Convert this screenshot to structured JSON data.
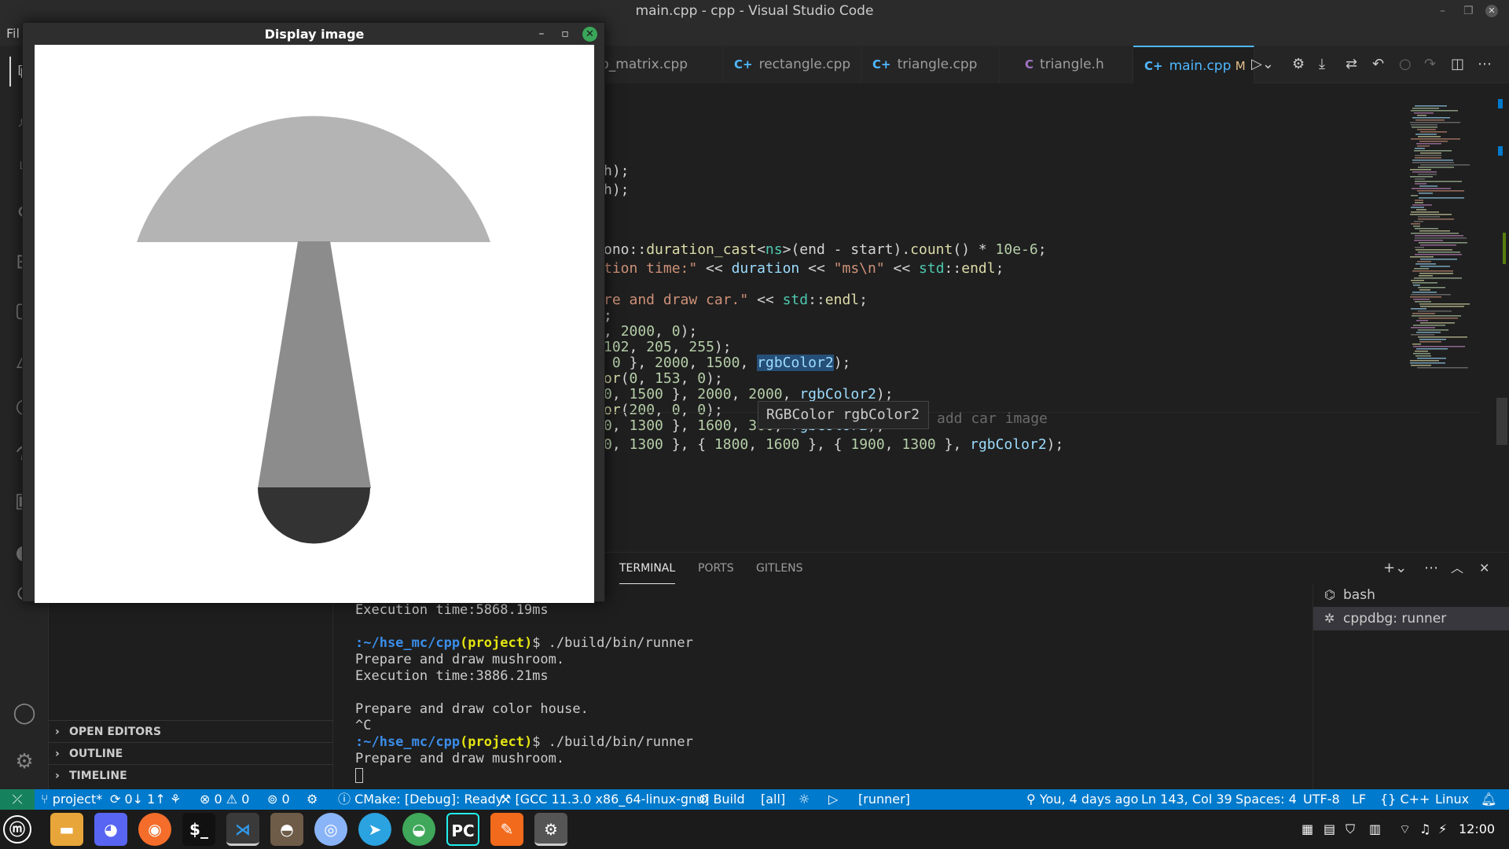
{
  "window": {
    "title": "main.cpp - cpp - Visual Studio Code",
    "controls": [
      "–",
      "❐",
      "✕"
    ]
  },
  "menu": {
    "visible_label": "Fil"
  },
  "tabs": [
    {
      "label": "b_matrix.cpp",
      "icon": ""
    },
    {
      "label": "rectangle.cpp",
      "icon": "C+"
    },
    {
      "label": "triangle.cpp",
      "icon": "C+"
    },
    {
      "label": "triangle.h",
      "icon": "C"
    },
    {
      "label": "main.cpp",
      "icon": "C+",
      "badge": "M",
      "active": true
    }
  ],
  "editor": {
    "lines": [
      [
        [
          "h);",
          ""
        ]
      ],
      [
        [
          "h);",
          ""
        ]
      ],
      [
        [
          "ono::",
          ""
        ],
        [
          "duration_cast",
          "fn"
        ],
        [
          "<",
          ""
        ],
        [
          "ns",
          "type"
        ],
        [
          ">(end - start).",
          ""
        ],
        [
          "count",
          "fn"
        ],
        [
          "() * ",
          ""
        ],
        [
          "10e-6",
          "num"
        ],
        [
          ";",
          ""
        ]
      ],
      [
        [
          "tion time:\"",
          "str"
        ],
        [
          " << ",
          ""
        ],
        [
          "duration",
          "var"
        ],
        [
          " << ",
          ""
        ],
        [
          "\"ms\\n\"",
          "str"
        ],
        [
          " << ",
          ""
        ],
        [
          "std",
          "type"
        ],
        [
          "::",
          ""
        ],
        [
          "endl",
          "fn"
        ],
        [
          ";",
          ""
        ]
      ],
      [
        [
          "re and draw car.\"",
          "str"
        ],
        [
          " << ",
          ""
        ],
        [
          "std",
          "type"
        ],
        [
          "::",
          ""
        ],
        [
          "endl",
          "fn"
        ],
        [
          ";",
          ""
        ]
      ],
      [
        [
          ";",
          ""
        ]
      ],
      [
        [
          ", ",
          ""
        ],
        [
          "2000",
          "num"
        ],
        [
          ", ",
          ""
        ],
        [
          "0",
          "num"
        ],
        [
          ");",
          ""
        ]
      ],
      [
        [
          "102",
          "num"
        ],
        [
          ", ",
          ""
        ],
        [
          "205",
          "num"
        ],
        [
          ", ",
          ""
        ],
        [
          "255",
          "num"
        ],
        [
          ");",
          ""
        ]
      ],
      [
        [
          " ",
          ""
        ],
        [
          "0",
          "num"
        ],
        [
          " }, ",
          ""
        ],
        [
          "2000",
          "num"
        ],
        [
          ", ",
          ""
        ],
        [
          "1500",
          "num"
        ],
        [
          ", ",
          ""
        ],
        [
          "rgbColor2",
          "hl"
        ],
        [
          ");",
          ""
        ]
      ],
      [
        [
          "or",
          "fn"
        ],
        [
          "(",
          ""
        ],
        [
          "0",
          "num"
        ],
        [
          ", ",
          ""
        ],
        [
          "153",
          "num"
        ],
        [
          ", ",
          ""
        ],
        [
          "0",
          "num"
        ],
        [
          ");",
          ""
        ]
      ],
      [
        [
          "0",
          "num"
        ],
        [
          ", ",
          ""
        ],
        [
          "1500",
          "num"
        ],
        [
          " }, ",
          ""
        ],
        [
          "2000",
          "num"
        ],
        [
          ", ",
          ""
        ],
        [
          "2000",
          "num"
        ],
        [
          ", ",
          ""
        ],
        [
          "rgbColor2",
          "var"
        ],
        [
          ");",
          ""
        ]
      ],
      [
        [
          "or",
          "fn"
        ],
        [
          "(",
          ""
        ],
        [
          "200",
          "num"
        ],
        [
          ", ",
          ""
        ],
        [
          "0",
          "num"
        ],
        [
          ", ",
          ""
        ],
        [
          "0",
          "num"
        ],
        [
          ");",
          ""
        ]
      ],
      [
        [
          "0",
          "num"
        ],
        [
          ", ",
          ""
        ],
        [
          "1300",
          "num"
        ],
        [
          " }, ",
          ""
        ],
        [
          "1600",
          "num"
        ],
        [
          ", ",
          ""
        ],
        [
          "300",
          "num"
        ],
        [
          ", ",
          ""
        ],
        [
          "rgbColor2",
          "var"
        ],
        [
          ");",
          ""
        ]
      ],
      [
        [
          "0",
          "num"
        ],
        [
          ", ",
          ""
        ],
        [
          "1300",
          "num"
        ],
        [
          " }, { ",
          ""
        ],
        [
          "1800",
          "num"
        ],
        [
          ", ",
          ""
        ],
        [
          "1600",
          "num"
        ],
        [
          " }, { ",
          ""
        ],
        [
          "1900",
          "num"
        ],
        [
          ", ",
          ""
        ],
        [
          "1300",
          "num"
        ],
        [
          " }, ",
          ""
        ],
        [
          "rgbColor2",
          "var"
        ],
        [
          ");",
          ""
        ]
      ]
    ],
    "hover_text": "RGBColor rgbColor2",
    "ghost_text": "add car image"
  },
  "sidebar": {
    "sections": [
      "OPEN EDITORS",
      "OUTLINE",
      "TIMELINE"
    ]
  },
  "panel": {
    "tabs": [
      "TERMINAL",
      "PORTS",
      "GITLENS"
    ],
    "active_tab": "TERMINAL",
    "terminal_lines": [
      {
        "text": "Execution time:5868.19ms"
      },
      {
        "text": ""
      },
      {
        "prompt": true,
        "path": ":~/hse_mc/cpp",
        "branch": "(project)",
        "cmd": "$ ./build/bin/runner"
      },
      {
        "text": "Prepare and draw mushroom."
      },
      {
        "text": "Execution time:3886.21ms"
      },
      {
        "text": ""
      },
      {
        "text": "Prepare and draw color house."
      },
      {
        "text": "^C"
      },
      {
        "prompt": true,
        "path": ":~/hse_mc/cpp",
        "branch": "(project)",
        "cmd": "$ ./build/bin/runner"
      },
      {
        "text": "Prepare and draw mushroom."
      }
    ],
    "terminal_list": [
      "bash",
      "cppdbg: runner"
    ]
  },
  "statusbar": {
    "branch": "project*",
    "sync": "0↓ 1↑",
    "problems": "⊗ 0 ⚠ 0",
    "ports": "0",
    "cmake": "CMake: [Debug]: Ready",
    "kit": "[GCC 11.3.0 x86_64-linux-gnu]",
    "build": "Build",
    "target": "[all]",
    "launch_target": "[runner]",
    "blame": "You, 4 days ago",
    "position": "Ln 143, Col 39",
    "spaces": "Spaces: 4",
    "encoding": "UTF-8",
    "eol": "LF",
    "language": "C++",
    "os": "Linux"
  },
  "display_window": {
    "title": "Display image",
    "colors": {
      "cap": "#b4b4b4",
      "stem": "#8c8c8c",
      "base": "#333333",
      "background": "#ffffff"
    }
  },
  "taskbar": {
    "apps": [
      "files",
      "discord",
      "firefox",
      "terminal",
      "vscode",
      "gimp",
      "chromium",
      "telegram",
      "network",
      "pycharm",
      "editor",
      "settings"
    ],
    "clock": "12:00"
  },
  "colors": {
    "accent": "#007acc",
    "active_tab": "#4fb8ff"
  }
}
